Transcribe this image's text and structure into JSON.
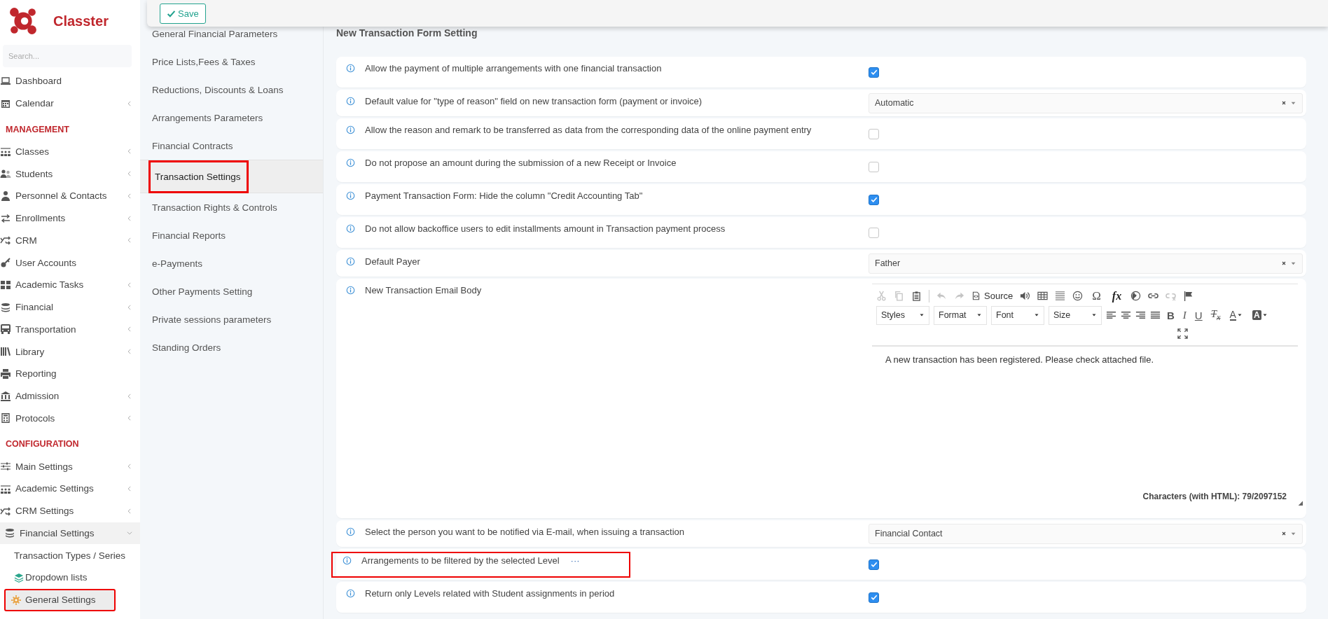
{
  "brand": {
    "name": "Classter"
  },
  "sidebar": {
    "search": {
      "placeholder": "Search..."
    },
    "sections": [
      {
        "items": [
          {
            "label": "Dashboard",
            "expandable": false,
            "expanded": false,
            "selected": false
          },
          {
            "label": "Calendar",
            "expandable": true,
            "expanded": false,
            "selected": false
          }
        ]
      },
      {
        "heading": "MANAGEMENT",
        "items": [
          {
            "label": "Classes",
            "expandable": true,
            "expanded": false,
            "selected": false
          },
          {
            "label": "Students",
            "expandable": true,
            "expanded": false,
            "selected": false
          },
          {
            "label": "Personnel & Contacts",
            "expandable": true,
            "expanded": false,
            "selected": false
          },
          {
            "label": "Enrollments",
            "expandable": true,
            "expanded": false,
            "selected": false
          },
          {
            "label": "CRM",
            "expandable": true,
            "expanded": false,
            "selected": false
          },
          {
            "label": "User Accounts",
            "expandable": false,
            "expanded": false,
            "selected": false
          },
          {
            "label": "Academic Tasks",
            "expandable": true,
            "expanded": false,
            "selected": false
          },
          {
            "label": "Financial",
            "expandable": true,
            "expanded": false,
            "selected": false
          },
          {
            "label": "Transportation",
            "expandable": true,
            "expanded": false,
            "selected": false
          },
          {
            "label": "Library",
            "expandable": true,
            "expanded": false,
            "selected": false
          },
          {
            "label": "Reporting",
            "expandable": false,
            "expanded": false,
            "selected": false
          },
          {
            "label": "Admission",
            "expandable": true,
            "expanded": false,
            "selected": false
          },
          {
            "label": "Protocols",
            "expandable": true,
            "expanded": false,
            "selected": false
          }
        ]
      },
      {
        "heading": "CONFIGURATION",
        "items": [
          {
            "label": "Main Settings",
            "expandable": true,
            "expanded": false,
            "selected": false
          },
          {
            "label": "Academic Settings",
            "expandable": true,
            "expanded": false,
            "selected": false
          },
          {
            "label": "CRM Settings",
            "expandable": true,
            "expanded": false,
            "selected": false
          },
          {
            "label": "Financial Settings",
            "expandable": true,
            "expanded": true,
            "selected": true,
            "children": [
              {
                "label": "Transaction Types / Series",
                "selected": false,
                "highlighted": false
              },
              {
                "label": "Dropdown lists",
                "selected": false,
                "highlighted": false
              },
              {
                "label": "General Settings",
                "selected": true,
                "highlighted": true
              }
            ]
          }
        ]
      }
    ]
  },
  "toolbar": {
    "save_button": {
      "label": "Save"
    }
  },
  "settings_menu": {
    "items": [
      {
        "label": "General Financial Parameters",
        "selected": false,
        "highlighted": false
      },
      {
        "label": "Price Lists,Fees & Taxes",
        "selected": false,
        "highlighted": false
      },
      {
        "label": "Reductions, Discounts & Loans",
        "selected": false,
        "highlighted": false
      },
      {
        "label": "Arrangements Parameters",
        "selected": false,
        "highlighted": false
      },
      {
        "label": "Financial Contracts",
        "selected": false,
        "highlighted": false
      },
      {
        "label": "Transaction Settings",
        "selected": true,
        "highlighted": true
      },
      {
        "label": "Transaction Rights & Controls",
        "selected": false,
        "highlighted": false
      },
      {
        "label": "Financial Reports",
        "selected": false,
        "highlighted": false
      },
      {
        "label": "e-Payments",
        "selected": false,
        "highlighted": false
      },
      {
        "label": "Other Payments Setting",
        "selected": false,
        "highlighted": false
      },
      {
        "label": "Private sessions parameters",
        "selected": false,
        "highlighted": false
      },
      {
        "label": "Standing Orders",
        "selected": false,
        "highlighted": false
      }
    ]
  },
  "form": {
    "title": "New Transaction Form Setting",
    "rows": [
      {
        "kind": "checkbox",
        "label": "Allow the payment of multiple arrangements with one financial transaction",
        "checked": true,
        "highlighted": false
      },
      {
        "kind": "select",
        "label": "Default value for \"type of reason\" field on new transaction form (payment or invoice)",
        "value": "Automatic",
        "highlighted": false
      },
      {
        "kind": "checkbox",
        "label": "Allow the reason and remark to be transferred as data from the corresponding data of the online payment entry",
        "checked": false,
        "highlighted": false
      },
      {
        "kind": "checkbox",
        "label": "Do not propose an amount during the submission of a new Receipt or Invoice",
        "checked": false,
        "highlighted": false
      },
      {
        "kind": "checkbox",
        "label": "Payment Transaction Form: Hide the column \"Credit Accounting Tab\"",
        "checked": true,
        "highlighted": false
      },
      {
        "kind": "checkbox",
        "label": "Do not allow backoffice users to edit installments amount in Transaction payment process",
        "checked": false,
        "highlighted": false
      },
      {
        "kind": "select",
        "label": "Default Payer",
        "value": "Father",
        "highlighted": false
      },
      {
        "kind": "editor",
        "label": "New Transaction Email Body",
        "highlighted": false,
        "editor": {
          "toolbar": [
            [
              {
                "kind": "cut",
                "disabled": true
              },
              {
                "kind": "copy",
                "disabled": true
              },
              {
                "kind": "paste",
                "disabled": false
              },
              {
                "kind": "separator"
              },
              {
                "kind": "undo",
                "disabled": true
              },
              {
                "kind": "redo",
                "disabled": true
              },
              {
                "kind": "source",
                "label": "Source",
                "disabled": false
              },
              {
                "kind": "speaker",
                "disabled": false
              },
              {
                "kind": "table",
                "disabled": false
              },
              {
                "kind": "rule",
                "disabled": false
              },
              {
                "kind": "smiley",
                "disabled": false
              },
              {
                "kind": "symbol",
                "label": "Ω",
                "disabled": false
              },
              {
                "kind": "formula",
                "label": "fx",
                "disabled": false
              },
              {
                "kind": "globe",
                "disabled": false
              },
              {
                "kind": "link",
                "disabled": false
              },
              {
                "kind": "unlink",
                "disabled": true
              },
              {
                "kind": "flag",
                "disabled": false
              }
            ],
            [
              {
                "kind": "dropdown",
                "label": "Styles"
              },
              {
                "kind": "dropdown",
                "label": "Format"
              },
              {
                "kind": "dropdown",
                "label": "Font"
              },
              {
                "kind": "dropdown",
                "label": "Size"
              },
              {
                "kind": "alignleft",
                "disabled": false
              },
              {
                "kind": "aligncenter",
                "disabled": false
              },
              {
                "kind": "alignright",
                "disabled": false
              },
              {
                "kind": "justify",
                "disabled": false
              },
              {
                "kind": "bold",
                "label": "B",
                "disabled": false
              },
              {
                "kind": "italic",
                "label": "I",
                "disabled": false
              },
              {
                "kind": "underline",
                "label": "U",
                "disabled": false
              },
              {
                "kind": "clearformat",
                "label": "T$_{x}$",
                "disabled": false
              },
              {
                "kind": "textcolor",
                "label": "A",
                "disabled": false
              },
              {
                "kind": "bgcolor",
                "label": "A",
                "disabled": false
              }
            ],
            [
              {
                "kind": "maximize",
                "disabled": false
              }
            ]
          ],
          "content": "A new transaction has been registered. Please check attached file.",
          "counter": "Characters (with HTML): 79/2097152"
        }
      },
      {
        "kind": "select",
        "label": "Select the person you want to be notified via E-mail, when issuing a transaction",
        "value": "Financial Contact",
        "highlighted": false
      },
      {
        "kind": "checkbox",
        "label": "Arrangements to be filtered by the selected Level",
        "checked": true,
        "highlighted": true,
        "more": "···"
      },
      {
        "kind": "checkbox",
        "label": "Return only Levels related with Student assignments in period",
        "checked": true,
        "highlighted": false
      }
    ]
  }
}
